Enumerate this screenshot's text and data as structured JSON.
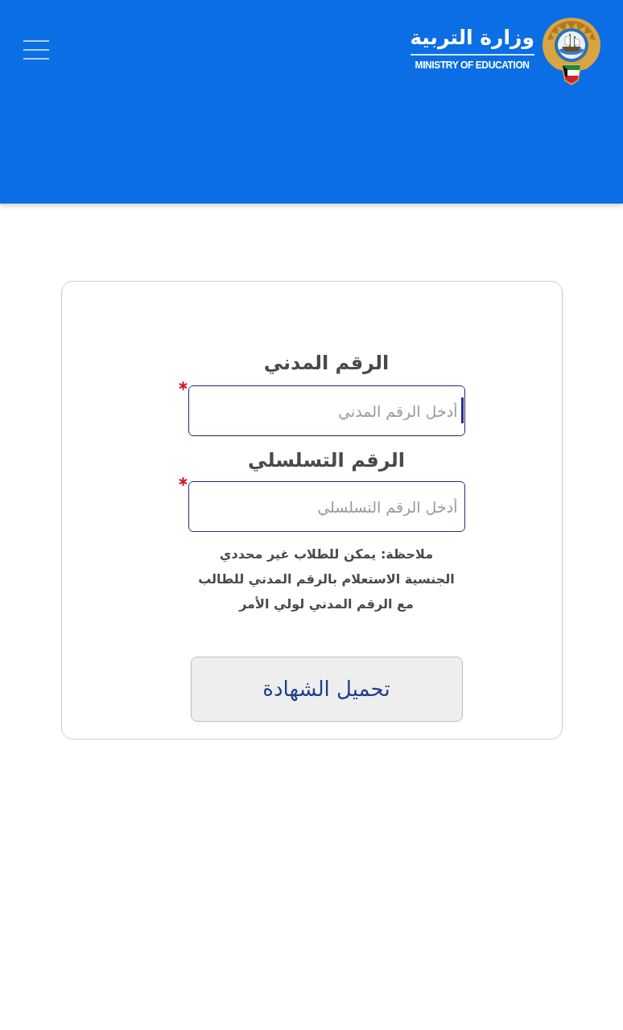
{
  "header": {
    "logo": {
      "title_ar": "وزارة التربية",
      "title_en": "MINISTRY OF EDUCATION"
    }
  },
  "form": {
    "fields": [
      {
        "label": "الرقم المدني",
        "placeholder": "أدخل الرقم المدني",
        "required": true,
        "focused": true
      },
      {
        "label": "الرقم التسلسلي",
        "placeholder": "أدخل الرقم التسلسلي",
        "required": true,
        "focused": false
      }
    ],
    "note": "ملاحظة: يمكن للطلاب غير محددي الجنسية الاستعلام بالرقم المدني للطالب مع الرقم المدني لولي الأمر",
    "submit_button": "تحميل الشهادة"
  }
}
